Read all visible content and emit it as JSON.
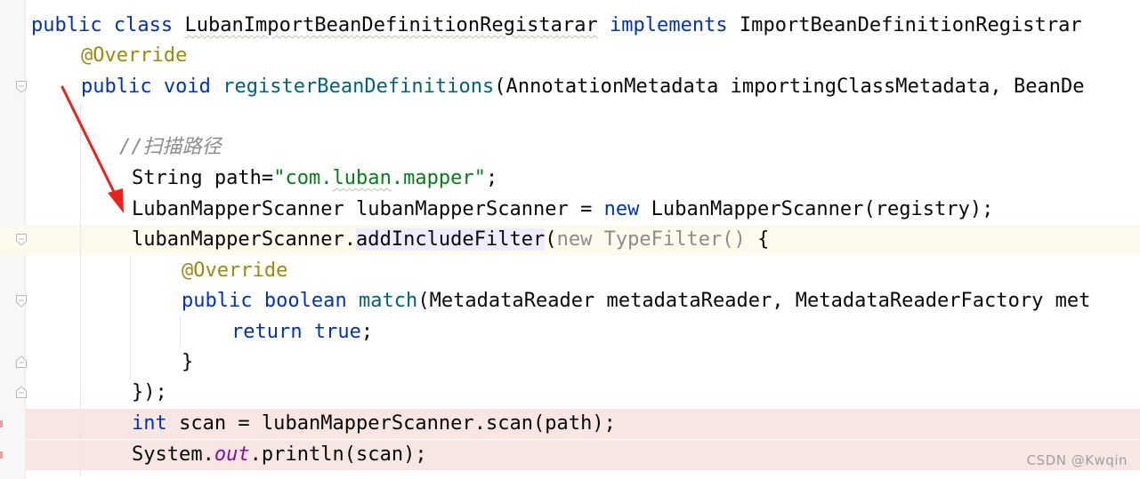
{
  "editor": {
    "lines": [
      {
        "tokens": [
          [
            "kw",
            "public "
          ],
          [
            "kw",
            "class "
          ],
          [
            "sq",
            "LubanImportBeanDefinitionRegistarar"
          ],
          [
            "plain",
            " "
          ],
          [
            "kw",
            "implements "
          ],
          [
            "plain",
            "ImportBeanDefinitionRegistrar"
          ]
        ]
      },
      {
        "tokens": [
          [
            "ann",
            "@Override"
          ]
        ]
      },
      {
        "tokens": [
          [
            "kw",
            "public "
          ],
          [
            "kw",
            "void "
          ],
          [
            "fn",
            "registerBeanDefinitions"
          ],
          [
            "plain",
            "(AnnotationMetadata importingClassMetadata, BeanDe"
          ]
        ]
      },
      {
        "tokens": []
      },
      {
        "tokens": [
          [
            "cmt",
            "//扫描路径"
          ]
        ]
      },
      {
        "tokens": [
          [
            "plain",
            "String path="
          ],
          [
            "str",
            "\"com."
          ],
          [
            "strsq",
            "luban"
          ],
          [
            "str",
            ".mapper\""
          ],
          [
            "plain",
            ";"
          ]
        ]
      },
      {
        "tokens": [
          [
            "plain",
            "LubanMapperScanner lubanMapperScanner = "
          ],
          [
            "kw",
            "new "
          ],
          [
            "plain",
            "LubanMapperScanner(registry);"
          ]
        ]
      },
      {
        "tokens": [
          [
            "plain",
            "lubanMapperScanner."
          ],
          [
            "hl",
            "addIncludeFilter"
          ],
          [
            "plain",
            "("
          ],
          [
            "dim",
            "new TypeFilter() "
          ],
          [
            "plain",
            "{"
          ]
        ]
      },
      {
        "tokens": [
          [
            "ann",
            "@Override"
          ]
        ]
      },
      {
        "tokens": [
          [
            "kw",
            "public "
          ],
          [
            "kw",
            "boolean "
          ],
          [
            "fn",
            "match"
          ],
          [
            "plain",
            "(MetadataReader metadataReader, MetadataReaderFactory met"
          ]
        ]
      },
      {
        "tokens": [
          [
            "kw",
            "return "
          ],
          [
            "kw",
            "true"
          ],
          [
            "plain",
            ";"
          ]
        ]
      },
      {
        "tokens": [
          [
            "plain",
            "}"
          ]
        ]
      },
      {
        "tokens": [
          [
            "plain",
            "});"
          ]
        ]
      },
      {
        "tokens": [
          [
            "kw",
            "int "
          ],
          [
            "plain",
            "scan = lubanMapperScanner.scan(path);"
          ]
        ]
      },
      {
        "tokens": [
          [
            "plain",
            "System."
          ],
          [
            "field",
            "out"
          ],
          [
            "plain",
            ".println(scan);"
          ]
        ]
      }
    ]
  },
  "watermark": "CSDN @Kwqin",
  "colors": {
    "keyword": "#0033b3",
    "annotation": "#9e880d",
    "method": "#00627a",
    "string": "#067d17",
    "comment": "#8c8c8c",
    "current_line": "#fcfaed",
    "error_line": "#f8e6e3",
    "arrow": "#e8231c"
  }
}
